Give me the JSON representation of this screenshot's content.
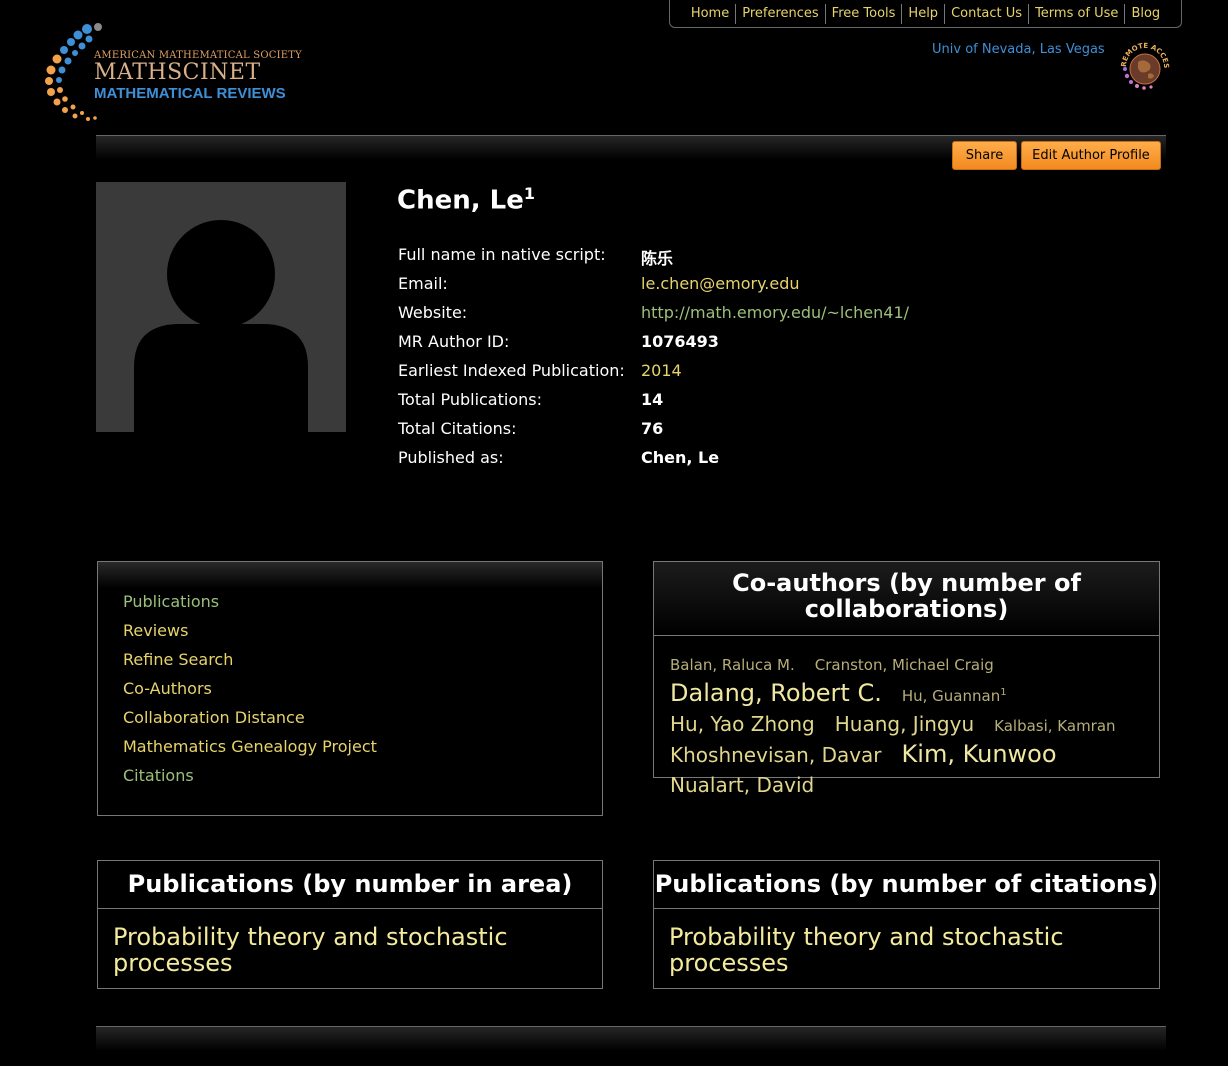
{
  "nav": {
    "items": [
      "Home",
      "Preferences",
      "Free Tools",
      "Help",
      "Contact Us",
      "Terms of Use",
      "Blog"
    ]
  },
  "logo": {
    "line1": "AMERICAN MATHEMATICAL SOCIETY",
    "line2": "MATHSCINET",
    "line3": "MATHEMATICAL REVIEWS"
  },
  "institution": "Univ of Nevada, Las Vegas",
  "remote_badge": {
    "text": "REMOTE ACCESS",
    "icon": "globe-icon"
  },
  "actions": {
    "share": "Share",
    "edit_profile": "Edit Author Profile"
  },
  "author": {
    "name": "Chen, Le",
    "superscript": "1",
    "fields": [
      {
        "label": "Full name in native script:",
        "value": "陈乐",
        "style": "bold"
      },
      {
        "label": "Email:",
        "value": "le.chen@emory.edu",
        "style": "link"
      },
      {
        "label": "Website:",
        "value": "http://math.emory.edu/~lchen41/",
        "style": "web"
      },
      {
        "label": "MR Author ID:",
        "value": "1076493",
        "style": "bold"
      },
      {
        "label": "Earliest Indexed Publication:",
        "value": "2014",
        "style": "link"
      },
      {
        "label": "Total Publications:",
        "value": "14",
        "style": "bold"
      },
      {
        "label": "Total Citations:",
        "value": "76",
        "style": "bold"
      },
      {
        "label": "Published as:",
        "value": "Chen, Le",
        "style": "bold"
      }
    ]
  },
  "menu": {
    "items": [
      {
        "label": "Publications",
        "color": "#9cc07a"
      },
      {
        "label": "Reviews",
        "color": "#e6d36a"
      },
      {
        "label": "Refine Search",
        "color": "#e6d36a"
      },
      {
        "label": "Co-Authors",
        "color": "#e6d36a"
      },
      {
        "label": "Collaboration Distance",
        "color": "#e6d36a"
      },
      {
        "label": "Mathematics Genealogy Project",
        "color": "#e6d36a"
      },
      {
        "label": "Citations",
        "color": "#9cc07a"
      }
    ]
  },
  "coauthors": {
    "title": "Co-authors (by number of collaborations)",
    "items": [
      {
        "name": "Balan, Raluca M.",
        "size": "sm"
      },
      {
        "name": "Cranston, Michael Craig",
        "size": "sm"
      },
      {
        "name": "Dalang, Robert C.",
        "size": "lg"
      },
      {
        "name": "Hu, Guannan",
        "size": "sm",
        "sup": "1"
      },
      {
        "name": "Hu, Yao Zhong",
        "size": "md"
      },
      {
        "name": "Huang, Jingyu",
        "size": "md"
      },
      {
        "name": "Kalbasi, Kamran",
        "size": "sm"
      },
      {
        "name": "Khoshnevisan, Davar",
        "size": "md"
      },
      {
        "name": "Kim, Kunwoo",
        "size": "lg"
      },
      {
        "name": "Nualart, David",
        "size": "md"
      }
    ]
  },
  "pubs_area": {
    "title": "Publications (by number in area)",
    "items": [
      "Probability theory and stochastic processes"
    ]
  },
  "pubs_citations": {
    "title": "Publications (by number of citations)",
    "items": [
      "Probability theory and stochastic processes"
    ]
  }
}
